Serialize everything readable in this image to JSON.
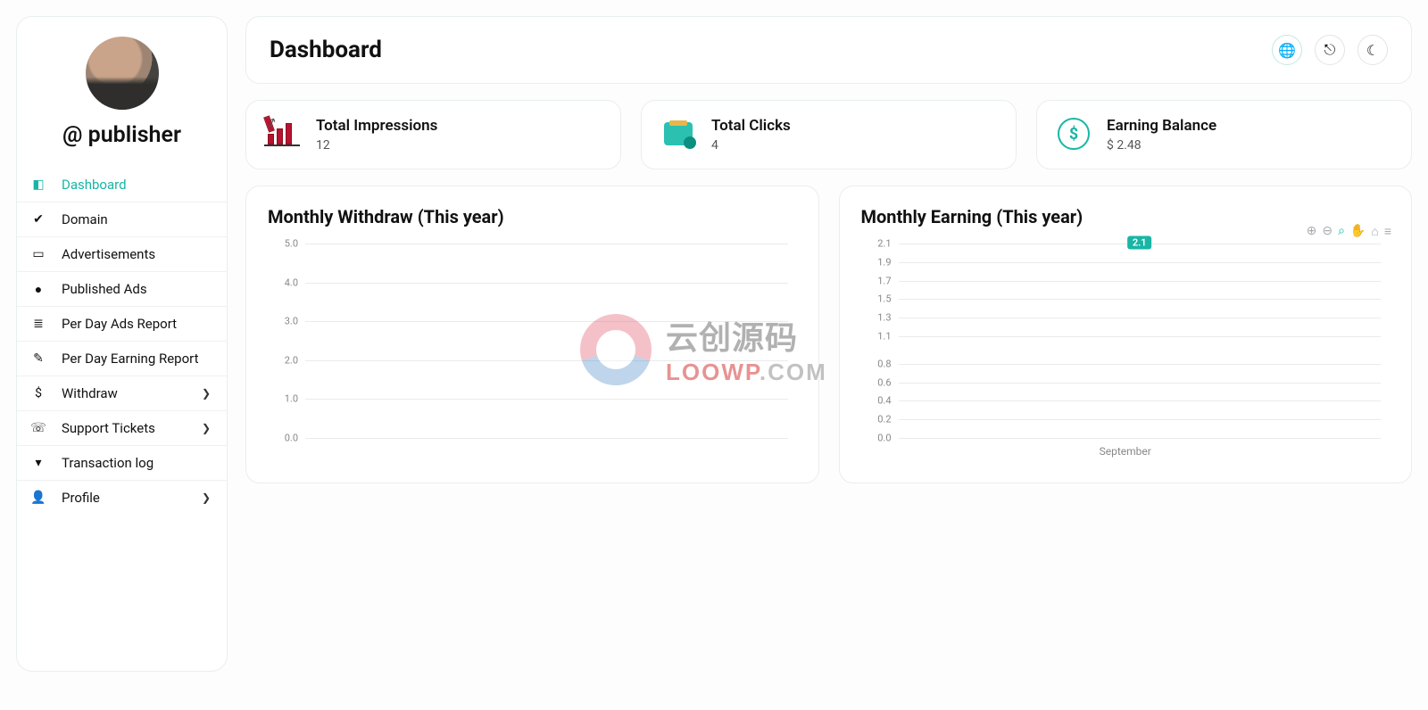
{
  "sidebar": {
    "username": "@ publisher",
    "items": [
      {
        "label": "Dashboard",
        "has_children": false,
        "icon": "dashboard"
      },
      {
        "label": "Domain",
        "has_children": false,
        "icon": "check-circle"
      },
      {
        "label": "Advertisements",
        "has_children": false,
        "icon": "ad"
      },
      {
        "label": "Published Ads",
        "has_children": false,
        "icon": "circle-a"
      },
      {
        "label": "Per Day Ads Report",
        "has_children": false,
        "icon": "list"
      },
      {
        "label": "Per Day Earning Report",
        "has_children": false,
        "icon": "signature"
      },
      {
        "label": "Withdraw",
        "has_children": true,
        "icon": "dollar"
      },
      {
        "label": "Support Tickets",
        "has_children": true,
        "icon": "headset"
      },
      {
        "label": "Transaction log",
        "has_children": false,
        "icon": "filter"
      },
      {
        "label": "Profile",
        "has_children": true,
        "icon": "user"
      }
    ],
    "active_index": 0
  },
  "header": {
    "title": "Dashboard"
  },
  "stats": {
    "impressions": {
      "title": "Total Impressions",
      "value": "12"
    },
    "clicks": {
      "title": "Total Clicks",
      "value": "4"
    },
    "balance": {
      "title": "Earning Balance",
      "value": "$ 2.48"
    }
  },
  "charts": {
    "withdraw": {
      "title": "Monthly Withdraw (This year)"
    },
    "earning": {
      "title": "Monthly Earning (This year)",
      "badge_text": "2.1"
    }
  },
  "watermark": {
    "cn": "云创源码",
    "en_red": "LOOWP",
    "en_grey": ".COM"
  },
  "chart_data": [
    {
      "id": "monthly_withdraw",
      "type": "line",
      "title": "Monthly Withdraw (This year)",
      "xlabel": "",
      "ylabel": "",
      "ylim": [
        0,
        5
      ],
      "y_ticks": [
        0.0,
        1.0,
        2.0,
        3.0,
        4.0,
        5.0
      ],
      "categories": [],
      "series": [
        {
          "name": "Withdraw",
          "values": []
        }
      ],
      "grid": true,
      "legend": false,
      "note": "No data points drawn; empty chart with y-axis gridlines only."
    },
    {
      "id": "monthly_earning",
      "type": "line",
      "title": "Monthly Earning (This year)",
      "xlabel": "",
      "ylabel": "",
      "ylim": [
        0.0,
        2.1
      ],
      "y_ticks": [
        0.0,
        0.2,
        0.4,
        0.6,
        0.8,
        1.1,
        1.3,
        1.5,
        1.7,
        1.9,
        2.1
      ],
      "categories": [
        "September"
      ],
      "series": [
        {
          "name": "Earning",
          "values": [
            2.1
          ]
        }
      ],
      "point_labels": [
        "2.1"
      ],
      "grid": true,
      "legend": false
    }
  ]
}
